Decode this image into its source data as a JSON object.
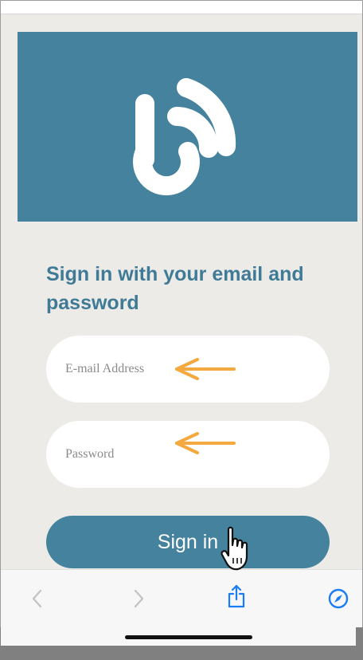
{
  "app": {
    "logo_icon": "wifi-signal-b-logo-icon",
    "brand_color": "#44829d",
    "background_color": "#ecebe7"
  },
  "form": {
    "heading": "Sign in with your email and password",
    "email_placeholder": "E-mail Address",
    "password_placeholder": "Password",
    "submit_label": "Sign in",
    "annotation_arrow_color": "#f4a940"
  },
  "browser_toolbar": {
    "back_icon": "chevron-left-icon",
    "forward_icon": "chevron-right-icon",
    "share_icon": "share-icon",
    "compass_icon": "compass-icon",
    "accent_color": "#1a7cf5"
  }
}
